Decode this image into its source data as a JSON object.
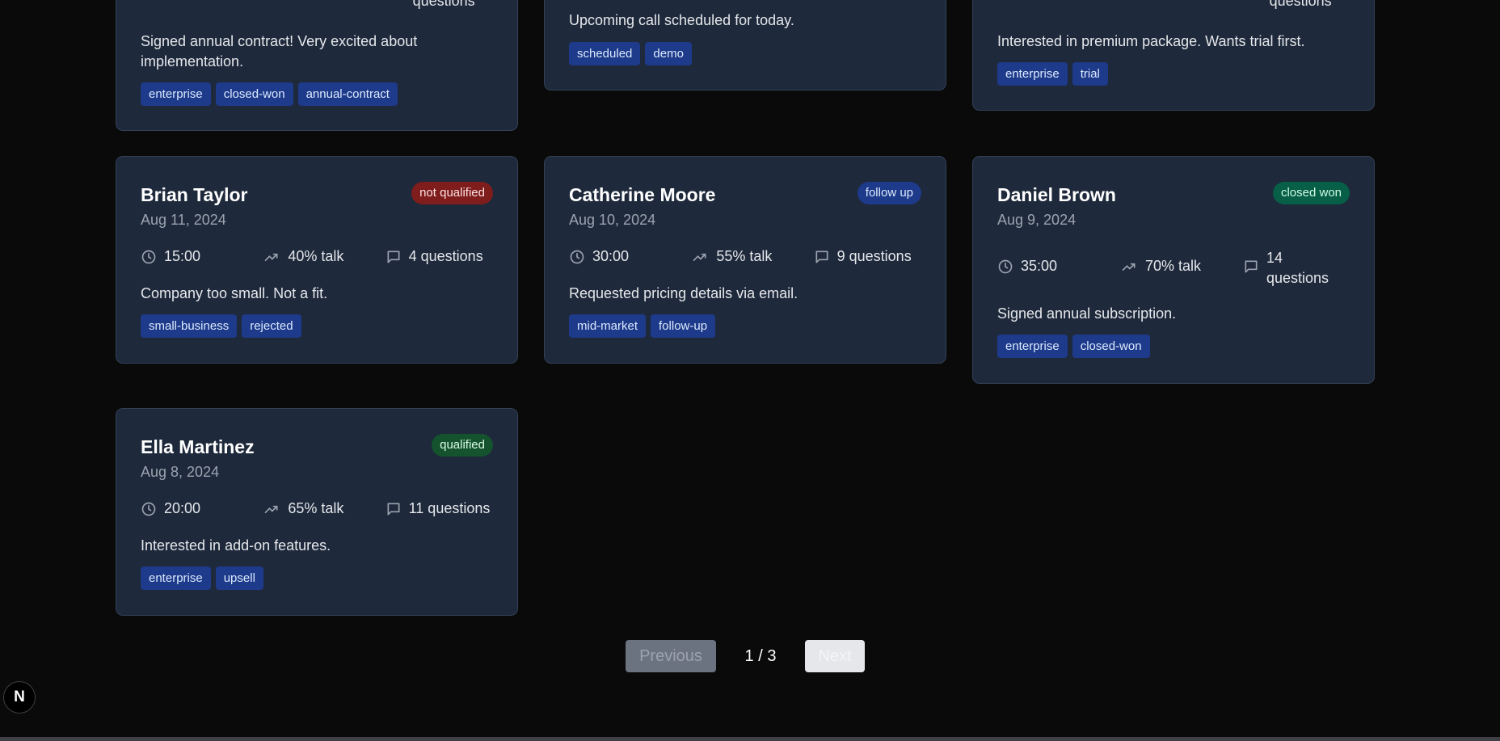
{
  "cards": [
    {
      "name": "",
      "date": "",
      "status": "",
      "metrics": {
        "duration": "",
        "talk": "",
        "questions": "questions"
      },
      "summary": "Signed annual contract! Very excited about implementation.",
      "tags": [
        "enterprise",
        "closed-won",
        "annual-contract"
      ]
    },
    {
      "name": "",
      "date": "",
      "status": "",
      "metrics": {
        "duration": "",
        "talk": "",
        "questions": ""
      },
      "summary": "Upcoming call scheduled for today.",
      "tags": [
        "scheduled",
        "demo"
      ]
    },
    {
      "name": "",
      "date": "",
      "status": "",
      "metrics": {
        "duration": "",
        "talk": "",
        "questions": "questions"
      },
      "summary": "Interested in premium package. Wants trial first.",
      "tags": [
        "enterprise",
        "trial"
      ]
    },
    {
      "name": "Brian Taylor",
      "date": "Aug 11, 2024",
      "status": "not qualified",
      "metrics": {
        "duration": "15:00",
        "talk": "40% talk",
        "questions": "4 questions"
      },
      "summary": "Company too small. Not a fit.",
      "tags": [
        "small-business",
        "rejected"
      ]
    },
    {
      "name": "Catherine Moore",
      "date": "Aug 10, 2024",
      "status": "follow up",
      "metrics": {
        "duration": "30:00",
        "talk": "55% talk",
        "questions": "9 questions"
      },
      "summary": "Requested pricing details via email.",
      "tags": [
        "mid-market",
        "follow-up"
      ]
    },
    {
      "name": "Daniel Brown",
      "date": "Aug 9, 2024",
      "status": "closed won",
      "metrics": {
        "duration": "35:00",
        "talk": "70% talk",
        "questions": "14 questions"
      },
      "summary": "Signed annual subscription.",
      "tags": [
        "enterprise",
        "closed-won"
      ]
    },
    {
      "name": "Ella Martinez",
      "date": "Aug 8, 2024",
      "status": "qualified",
      "metrics": {
        "duration": "20:00",
        "talk": "65% talk",
        "questions": "11 questions"
      },
      "summary": "Interested in add-on features.",
      "tags": [
        "enterprise",
        "upsell"
      ]
    }
  ],
  "pagination": {
    "previous_label": "Previous",
    "page_indicator": "1 / 3",
    "next_label": "Next"
  },
  "logo": {
    "letter": "N"
  },
  "colors": {
    "background": "#0a0a0a",
    "card": "#1e293b",
    "tag": "#1e3a8a",
    "not_qualified": "#7f1d1d",
    "follow_up": "#1e3a8a",
    "closed_won": "#065f46",
    "qualified": "#14532d"
  }
}
